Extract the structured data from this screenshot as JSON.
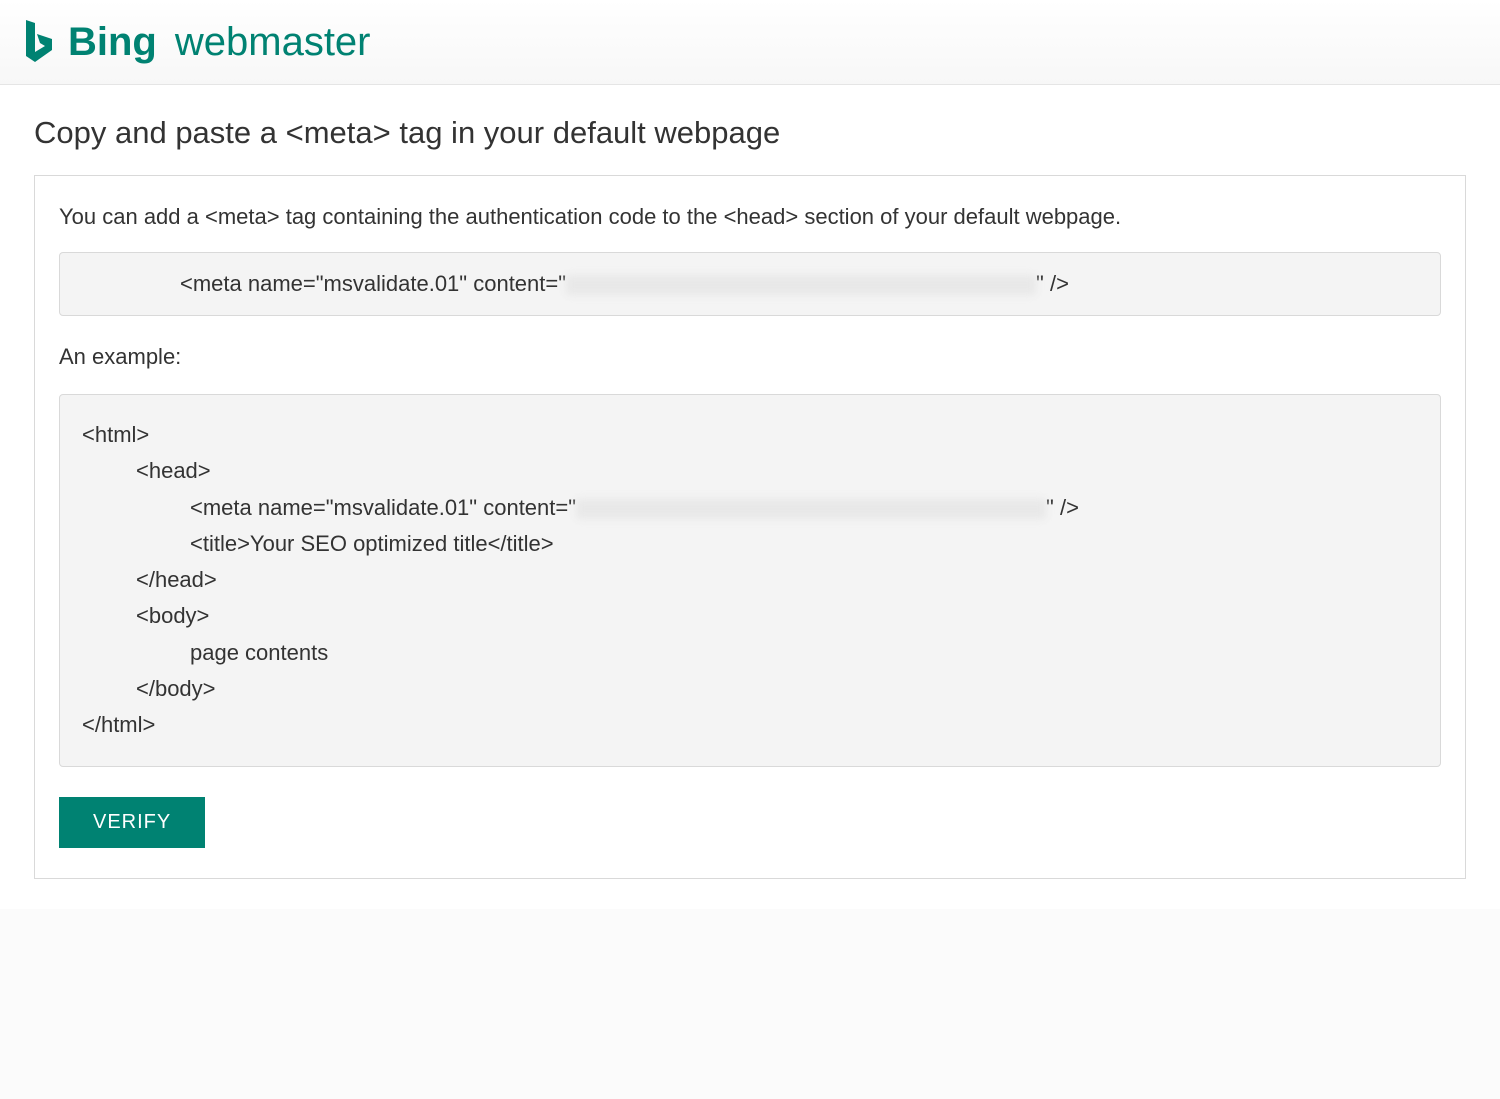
{
  "header": {
    "brand": "Bing",
    "product": "webmaster"
  },
  "main": {
    "title": "Copy and paste a <meta> tag in your default webpage",
    "intro": "You can add a <meta> tag containing the authentication code to the <head> section of your default webpage.",
    "meta_tag_prefix": "<meta name=\"msvalidate.01\" content=\"",
    "meta_tag_suffix": "\" />",
    "example_label": "An example:",
    "example": {
      "html_open": "<html>",
      "head_open": "<head>",
      "meta_line_prefix": "<meta name=\"msvalidate.01\" content=\"",
      "meta_line_suffix": "\" />",
      "title_line": "<title>Your SEO optimized title</title>",
      "head_close": "</head>",
      "body_open": "<body>",
      "body_content": "page contents",
      "body_close": "</body>",
      "html_close": "</html>"
    },
    "verify_label": "VERIFY"
  }
}
